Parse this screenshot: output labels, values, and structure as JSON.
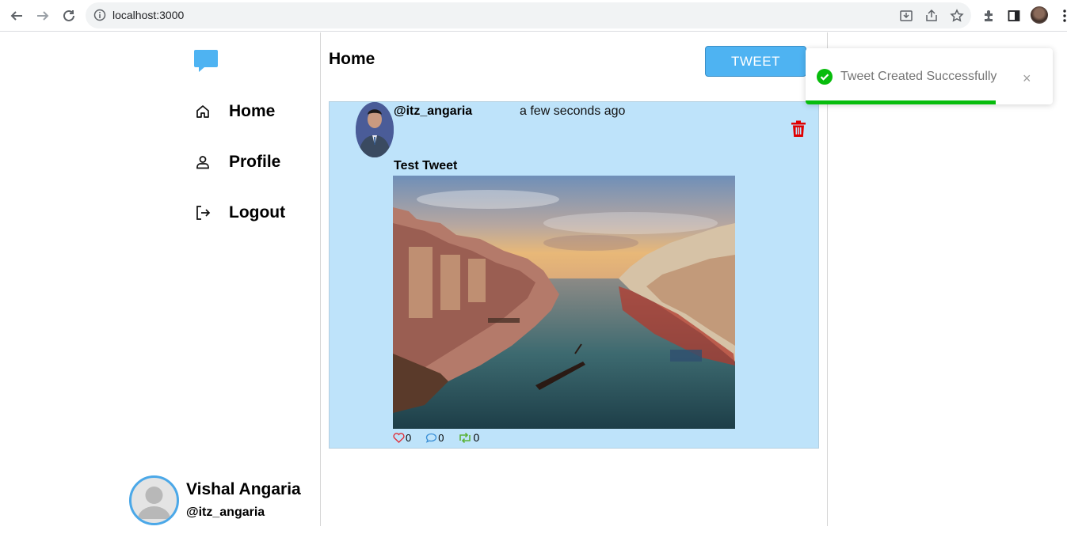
{
  "browser": {
    "url": "localhost:3000"
  },
  "sidebar": {
    "items": [
      {
        "label": "Home",
        "icon": "home-icon"
      },
      {
        "label": "Profile",
        "icon": "user-icon"
      },
      {
        "label": "Logout",
        "icon": "logout-icon"
      }
    ],
    "profile": {
      "name": "Vishal Angaria",
      "handle": "@itz_angaria"
    }
  },
  "main": {
    "title": "Home",
    "tweet_button": "TWEET",
    "tweet": {
      "username": "@itz_angaria",
      "time": "a few seconds ago",
      "text": "Test Tweet",
      "likes": "0",
      "comments": "0",
      "retweets": "0"
    }
  },
  "toast": {
    "message": "Tweet Created Successfully",
    "close": "×",
    "progress": 0.77
  },
  "colors": {
    "accent": "#4eb3f2",
    "card_bg": "#bee3fa",
    "success": "#07bc0c",
    "danger": "#e00000"
  }
}
